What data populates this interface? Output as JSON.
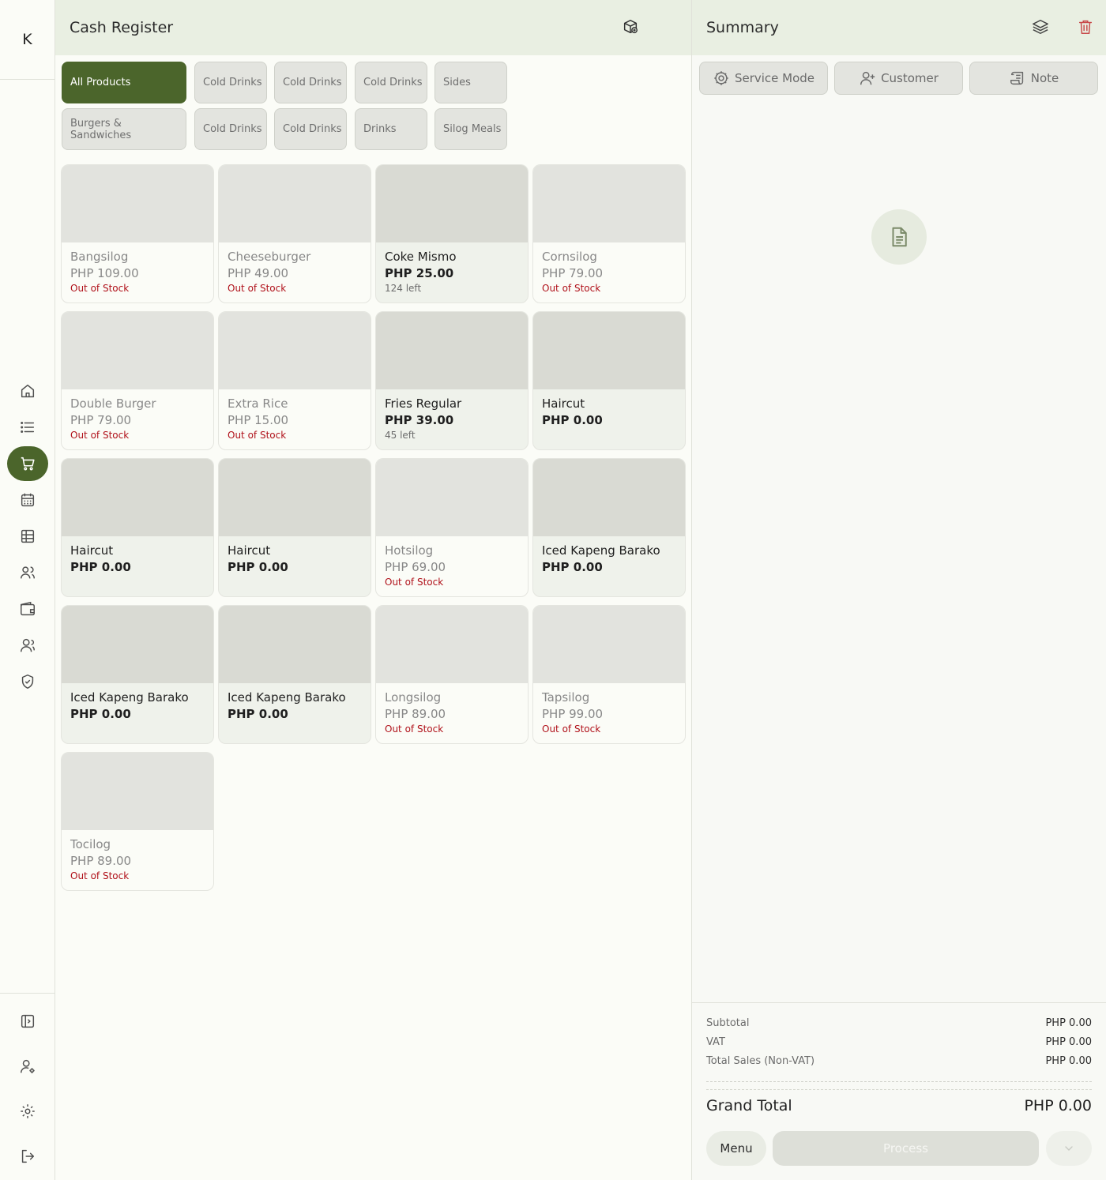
{
  "rail": {
    "logo": "K",
    "nav": [
      "home-icon",
      "list-icon",
      "cart-icon",
      "calendar-icon",
      "table-icon",
      "users-icon",
      "wallet-icon",
      "team-icon",
      "shield-icon"
    ],
    "active": "cart-icon",
    "bottom": [
      "sidebar-toggle-icon",
      "user-settings-icon",
      "gear-icon",
      "logout-icon"
    ]
  },
  "register": {
    "title": "Cash Register",
    "categories": [
      {
        "label": "All Products",
        "active": true
      },
      {
        "label": "Cold Drinks"
      },
      {
        "label": "Cold Drinks"
      },
      {
        "label": "Cold Drinks"
      },
      {
        "label": "Sides"
      },
      {
        "label": "Burgers & Sandwiches"
      },
      {
        "label": "Cold Drinks"
      },
      {
        "label": "Cold Drinks"
      },
      {
        "label": "Drinks"
      },
      {
        "label": "Silog Meals"
      }
    ],
    "products": [
      {
        "name": "Bangsilog",
        "price": "PHP 109.00",
        "stock": "Out of Stock",
        "available": false
      },
      {
        "name": "Cheeseburger",
        "price": "PHP 49.00",
        "stock": "Out of Stock",
        "available": false
      },
      {
        "name": "Coke Mismo",
        "price": "PHP 25.00",
        "stock": "124 left",
        "available": true
      },
      {
        "name": "Cornsilog",
        "price": "PHP 79.00",
        "stock": "Out of Stock",
        "available": false
      },
      {
        "name": "Double Burger",
        "price": "PHP 79.00",
        "stock": "Out of Stock",
        "available": false
      },
      {
        "name": "Extra Rice",
        "price": "PHP 15.00",
        "stock": "Out of Stock",
        "available": false
      },
      {
        "name": "Fries Regular",
        "price": "PHP 39.00",
        "stock": "45 left",
        "available": true
      },
      {
        "name": "Haircut",
        "price": "PHP 0.00",
        "stock": "",
        "available": true
      },
      {
        "name": "Haircut",
        "price": "PHP 0.00",
        "stock": "",
        "available": true
      },
      {
        "name": "Haircut",
        "price": "PHP 0.00",
        "stock": "",
        "available": true
      },
      {
        "name": "Hotsilog",
        "price": "PHP 69.00",
        "stock": "Out of Stock",
        "available": false
      },
      {
        "name": "Iced Kapeng Barako",
        "price": "PHP 0.00",
        "stock": "",
        "available": true
      },
      {
        "name": "Iced Kapeng Barako",
        "price": "PHP 0.00",
        "stock": "",
        "available": true
      },
      {
        "name": "Iced Kapeng Barako",
        "price": "PHP 0.00",
        "stock": "",
        "available": true
      },
      {
        "name": "Longsilog",
        "price": "PHP 89.00",
        "stock": "Out of Stock",
        "available": false
      },
      {
        "name": "Tapsilog",
        "price": "PHP 99.00",
        "stock": "Out of Stock",
        "available": false
      },
      {
        "name": "Tocilog",
        "price": "PHP 89.00",
        "stock": "Out of Stock",
        "available": false
      }
    ]
  },
  "summary": {
    "title": "Summary",
    "service_mode": "Service Mode",
    "customer": "Customer",
    "note": "Note",
    "subtotal_label": "Subtotal",
    "subtotal_value": "PHP 0.00",
    "vat_label": "VAT",
    "vat_value": "PHP 0.00",
    "nonvat_label": "Total Sales (Non-VAT)",
    "nonvat_value": "PHP 0.00",
    "grand_label": "Grand Total",
    "grand_value": "PHP 0.00",
    "menu_label": "Menu",
    "process_label": "Process"
  },
  "colors": {
    "accent": "#4b652b",
    "header_bg": "#e9efe2",
    "out_of_stock": "#b0111a",
    "trash": "#c84a4a"
  }
}
